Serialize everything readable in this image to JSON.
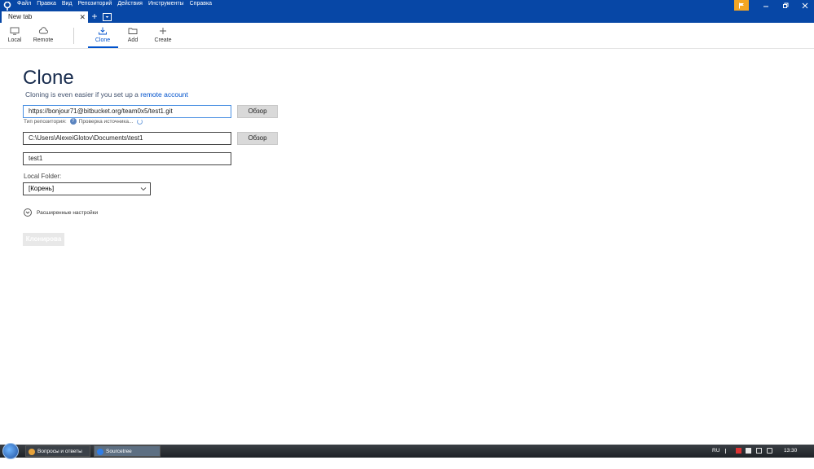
{
  "titlebar": {
    "menu": [
      "Файл",
      "Правка",
      "Вид",
      "Репозиторий",
      "Действия",
      "Инструменты",
      "Справка"
    ],
    "tab_label": "New tab",
    "tab_close": "✕",
    "tab_add": "+"
  },
  "toolbar": {
    "items": [
      {
        "label": "Local",
        "icon": "monitor-icon"
      },
      {
        "label": "Remote",
        "icon": "cloud-icon"
      },
      {
        "label": "Clone",
        "icon": "download-icon",
        "active": true
      },
      {
        "label": "Add",
        "icon": "folder-icon"
      },
      {
        "label": "Create",
        "icon": "plus-icon"
      }
    ]
  },
  "main": {
    "title": "Clone",
    "subtitle_text": "Cloning is even easier if you set up a",
    "subtitle_link": "remote account",
    "source_url": "https://bonjour71@bitbucket.org/team0x5/test1.git",
    "browse_label": "Обзор",
    "repo_type_label": "Тип репозитория:",
    "repo_type_status": "Проверка источника...",
    "dest_path": "C:\\Users\\AlexeiGlotov\\Documents\\test1",
    "name_value": "test1",
    "local_folder_label": "Local Folder:",
    "local_folder_value": "[Корень]",
    "advanced_label": "Расширенные настройки",
    "clone_button": "Клонирова"
  },
  "taskbar": {
    "items": [
      {
        "label": "Вопросы и ответы в...",
        "active": false
      },
      {
        "label": "Sourcetree",
        "active": true
      }
    ],
    "lang": "RU",
    "time": "13:30"
  },
  "colors": {
    "titlebar_bg": "#0747a6",
    "accent": "#0052cc",
    "notification": "#f5a623"
  }
}
